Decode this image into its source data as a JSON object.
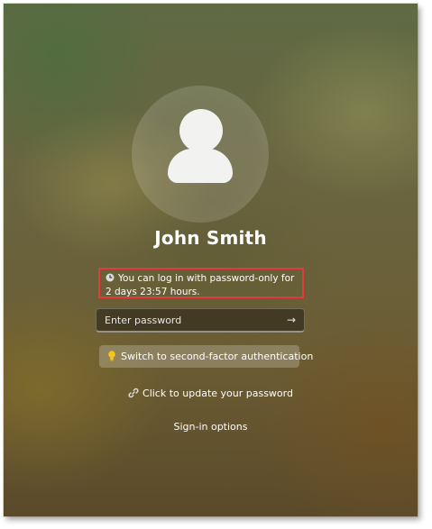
{
  "user": {
    "name": "John Smith"
  },
  "notice": {
    "icon": "clock-icon",
    "text": "You can log in with password-only for 2 days 23:57 hours."
  },
  "password": {
    "placeholder": "Enter password",
    "value": "",
    "submit_icon": "arrow-right-icon"
  },
  "second_factor": {
    "icon": "lightbulb-icon",
    "label": "Switch to second-factor authentication"
  },
  "update_password": {
    "icon": "link-icon",
    "label": "Click to update your password"
  },
  "signin_options": {
    "label": "Sign-in options"
  },
  "colors": {
    "highlight_border": "#e23b3b",
    "bulb": "#f5c518",
    "text": "#ffffff"
  }
}
